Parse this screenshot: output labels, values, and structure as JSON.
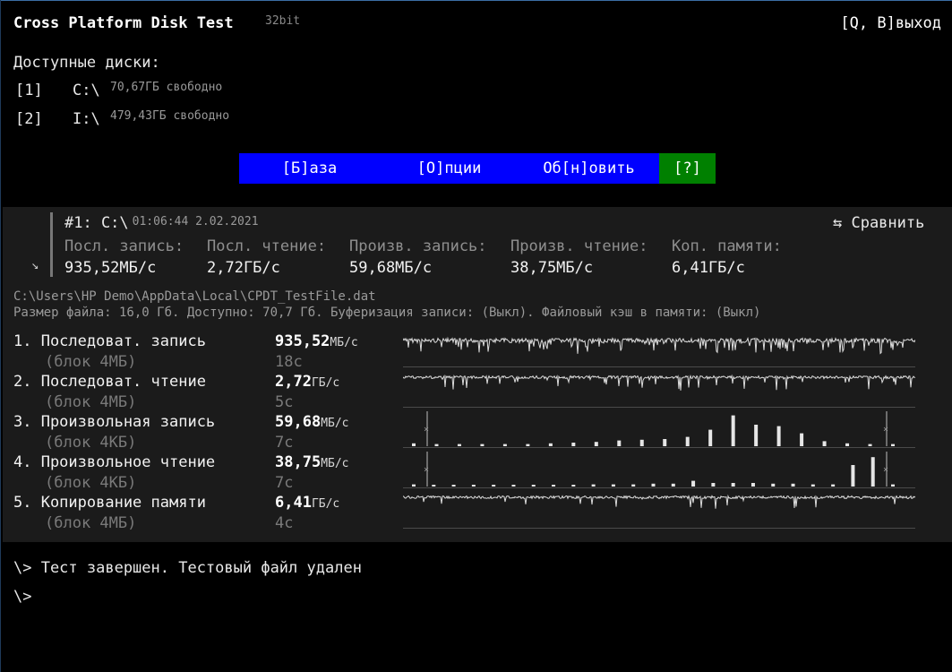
{
  "app": {
    "title": "Cross Platform Disk Test",
    "bits": "32bit",
    "exit_label": "[Q, B]выход"
  },
  "drives": {
    "label": "Доступные диски:",
    "items": [
      {
        "key": "[1]",
        "letter": "C:\\",
        "free": "70,67ГБ свободно"
      },
      {
        "key": "[2]",
        "letter": "I:\\",
        "free": "479,43ГБ свободно"
      }
    ]
  },
  "menu": {
    "items": [
      {
        "label": "[Б]аза"
      },
      {
        "label": "[О]пции"
      },
      {
        "label": "Об[н]овить"
      },
      {
        "label": "[?]"
      }
    ]
  },
  "session": {
    "title": "#1: C:\\",
    "timestamp": "01:06:44 2.02.2021",
    "compare_label": "⇆ Сравнить",
    "expand_icon": "↘",
    "summary": [
      {
        "label": "Посл. запись:",
        "value": "935,52МБ/с"
      },
      {
        "label": "Посл. чтение:",
        "value": "2,72ГБ/с"
      },
      {
        "label": "Произв. запись:",
        "value": "59,68МБ/с"
      },
      {
        "label": "Произв. чтение:",
        "value": "38,75МБ/с"
      },
      {
        "label": "Коп. памяти:",
        "value": "6,41ГБ/с"
      }
    ],
    "path": "C:\\Users\\HP Demo\\AppData\\Local\\CPDT_TestFile.dat",
    "info": "Размер файла: 16,0 Гб. Доступно: 70,7 Гб. Буферизация записи: (Выкл). Файловый кэш в памяти: (Выкл)"
  },
  "tests": [
    {
      "name": "1. Последоват. запись",
      "block": "(блок 4МБ)",
      "value": "935,52",
      "unit": "МБ/с",
      "time": "18с"
    },
    {
      "name": "2. Последоват. чтение",
      "block": "(блок 4МБ)",
      "value": "2,72",
      "unit": "ГБ/с",
      "time": "5с"
    },
    {
      "name": "3. Произвольная запись",
      "block": "(блок 4КБ)",
      "value": "59,68",
      "unit": "МБ/с",
      "time": "7с"
    },
    {
      "name": "4. Произвольное чтение",
      "block": "(блок 4КБ)",
      "value": "38,75",
      "unit": "МБ/с",
      "time": "7с"
    },
    {
      "name": "5. Копирование памяти",
      "block": "(блок 4МБ)",
      "value": "6,41",
      "unit": "ГБ/с",
      "time": "4с"
    }
  ],
  "graphs": {
    "rand_write_bars": [
      0.08,
      0.06,
      0.06,
      0.06,
      0.06,
      0.06,
      0.08,
      0.1,
      0.12,
      0.16,
      0.18,
      0.2,
      0.26,
      0.46,
      0.86,
      0.6,
      0.56,
      0.36,
      0.14,
      0.08,
      0.06,
      0.06
    ],
    "rand_read_bars": [
      0.06,
      0.04,
      0.04,
      0.04,
      0.04,
      0.04,
      0.04,
      0.04,
      0.04,
      0.06,
      0.06,
      0.06,
      0.08,
      0.08,
      0.16,
      0.1,
      0.1,
      0.1,
      0.08,
      0.08,
      0.06,
      0.06,
      0.6,
      0.82,
      0.06
    ]
  },
  "log": {
    "lines": [
      "\\> Тест завершен. Тестовый файл удален",
      "\\>"
    ]
  }
}
